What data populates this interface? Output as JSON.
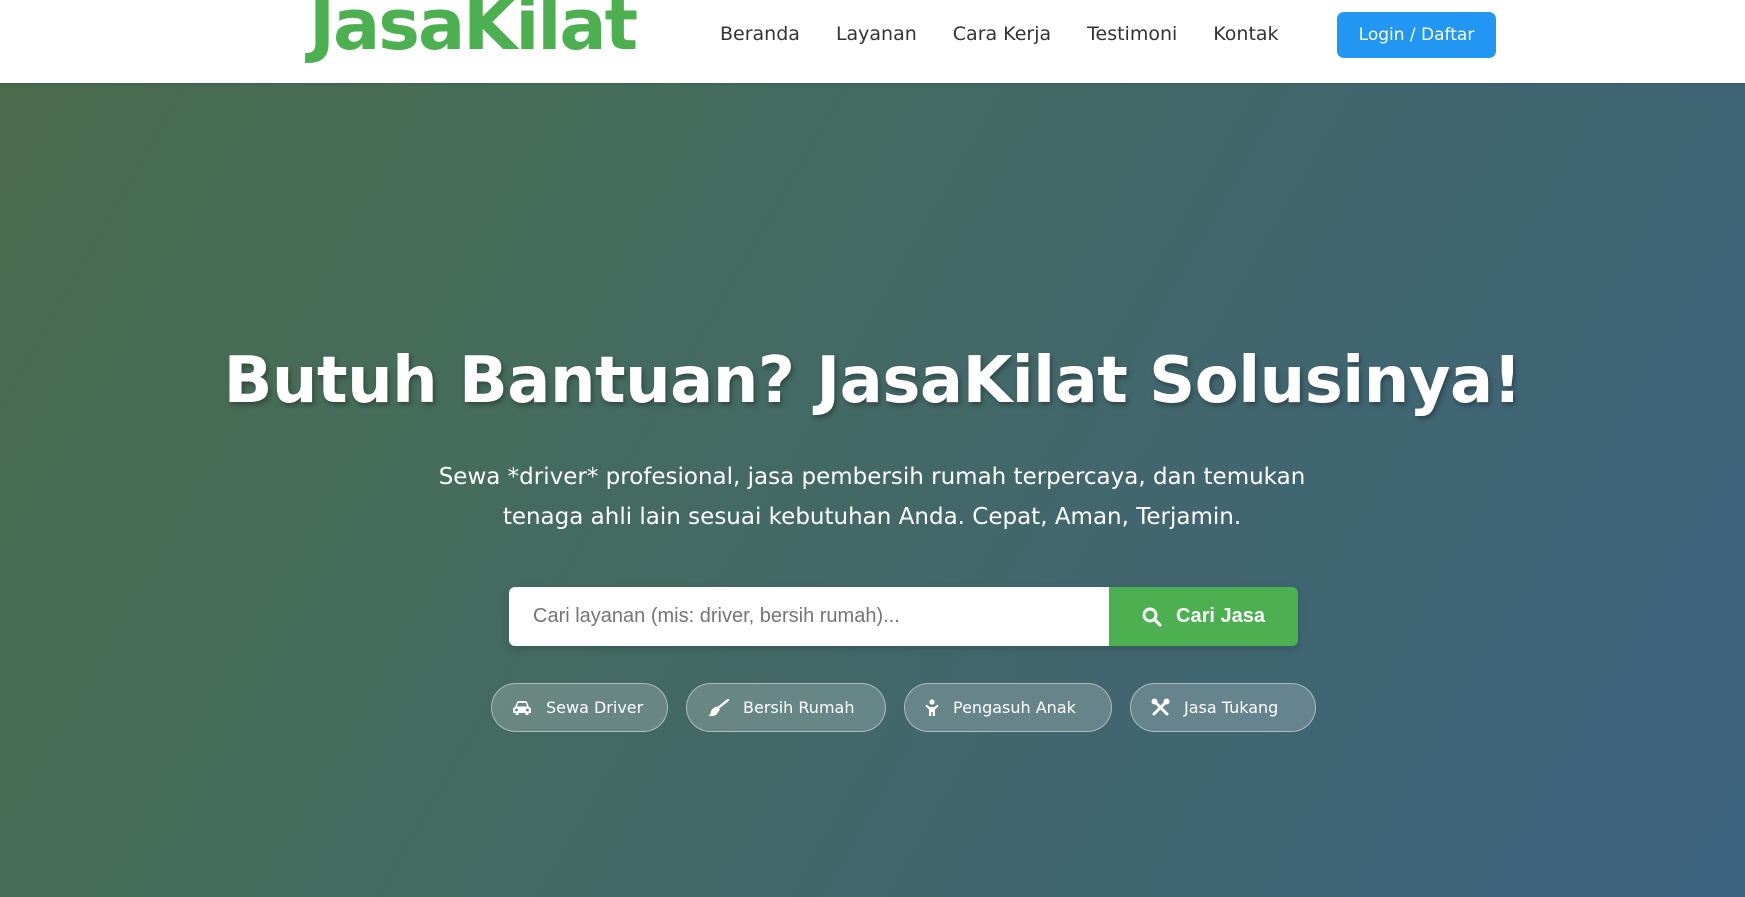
{
  "brand": {
    "logo_text": "JasaKilat",
    "primary_color": "#4caf50",
    "accent_color": "#2196f3"
  },
  "nav": {
    "items": [
      {
        "label": "Beranda"
      },
      {
        "label": "Layanan"
      },
      {
        "label": "Cara Kerja"
      },
      {
        "label": "Testimoni"
      },
      {
        "label": "Kontak"
      }
    ],
    "login_label": "Login / Daftar"
  },
  "hero": {
    "title": "Butuh Bantuan? JasaKilat Solusinya!",
    "subtitle": "Sewa *driver* profesional, jasa pembersih rumah terpercaya, dan temukan tenaga ahli lain sesuai kebutuhan Anda. Cepat, Aman, Terjamin."
  },
  "search": {
    "placeholder": "Cari layanan (mis: driver, bersih rumah)...",
    "value": "",
    "button_label": "Cari Jasa",
    "button_icon": "search-icon"
  },
  "categories": [
    {
      "label": "Sewa Driver",
      "icon": "car-icon"
    },
    {
      "label": "Bersih Rumah",
      "icon": "broom-icon"
    },
    {
      "label": "Pengasuh Anak",
      "icon": "child-icon"
    },
    {
      "label": "Jasa Tukang",
      "icon": "tools-icon"
    }
  ]
}
